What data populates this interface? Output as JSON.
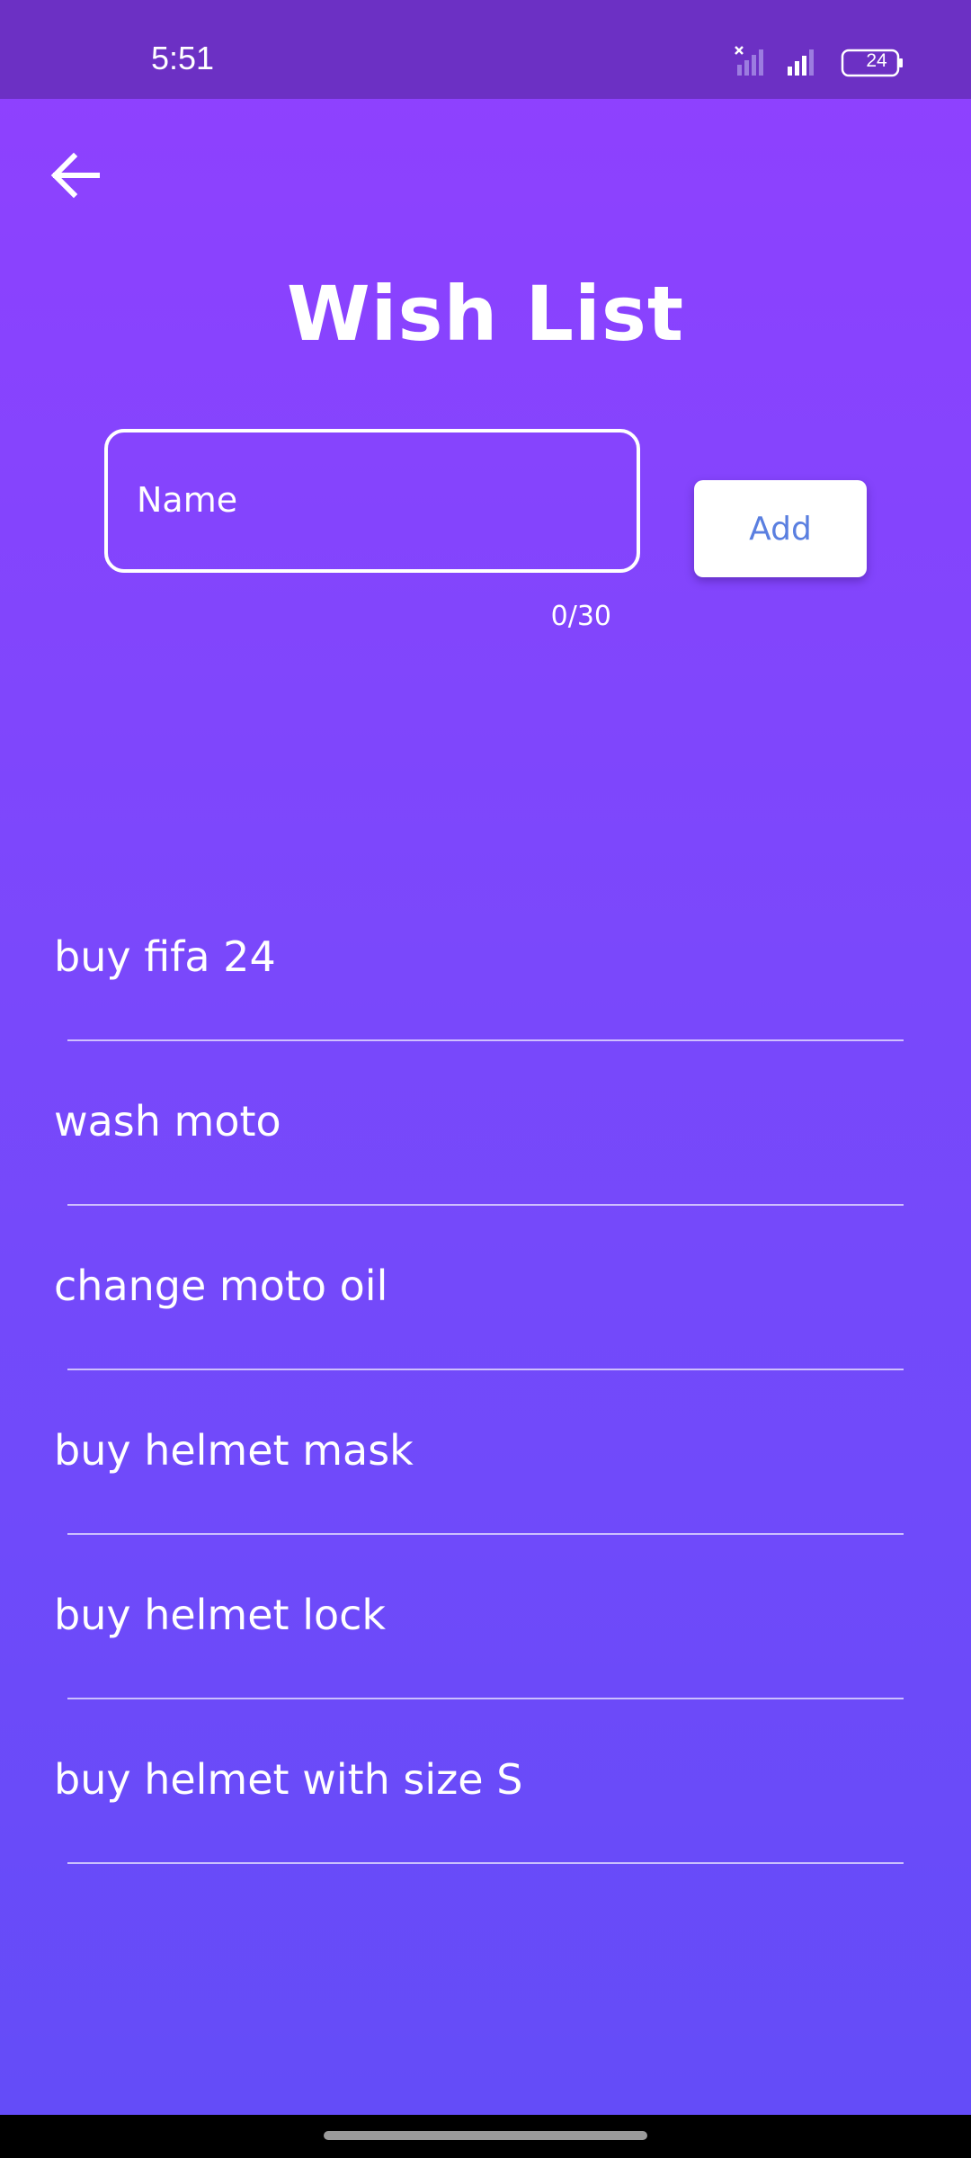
{
  "status_bar": {
    "time": "5:51",
    "battery_level": "24",
    "icons": [
      "signal-no-service-icon",
      "signal-strength-icon",
      "battery-icon"
    ]
  },
  "header": {
    "back_icon": "arrow-left-icon",
    "title": "Wish List"
  },
  "form": {
    "name_placeholder": "Name",
    "name_value": "",
    "char_counter": "0/30",
    "add_label": "Add"
  },
  "wish_list": {
    "items": [
      {
        "label": "buy fifa 24"
      },
      {
        "label": "wash moto"
      },
      {
        "label": "change moto oil"
      },
      {
        "label": "buy helmet mask"
      },
      {
        "label": "buy helmet lock"
      },
      {
        "label": "buy helmet with size S"
      }
    ]
  },
  "colors": {
    "status_bar": "#6c30c4",
    "gradient_top": "#9040ff",
    "gradient_bottom": "#634cf8",
    "add_button_text": "#5a7fe0"
  }
}
